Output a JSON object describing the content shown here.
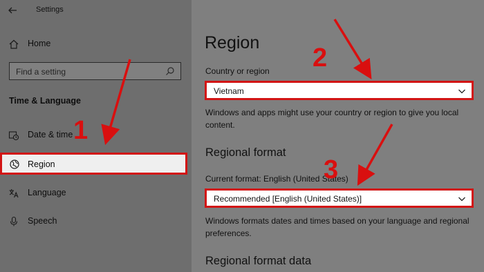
{
  "window": {
    "title": "Settings"
  },
  "sidebar": {
    "home_label": "Home",
    "search_placeholder": "Find a setting",
    "section_title": "Time & Language",
    "items": [
      {
        "label": "Date & time",
        "icon": "calendar-clock-icon"
      },
      {
        "label": "Region",
        "icon": "globe-icon",
        "selected": true
      },
      {
        "label": "Language",
        "icon": "language-icon"
      },
      {
        "label": "Speech",
        "icon": "microphone-icon"
      }
    ]
  },
  "main": {
    "title": "Region",
    "country": {
      "label": "Country or region",
      "value": "Vietnam",
      "description_line1": "Windows and apps might use your country or region to give you local",
      "description_line2": "content."
    },
    "regional_format": {
      "title": "Regional format",
      "current_label": "Current format: English (United States)",
      "value": "Recommended [English (United States)]",
      "description_line1": "Windows formats dates and times based on your language and regional",
      "description_line2": "preferences."
    },
    "regional_format_data": {
      "title": "Regional format data"
    }
  },
  "annotations": {
    "step1": "1",
    "step2": "2",
    "step3": "3",
    "color": "#d90f0f"
  }
}
